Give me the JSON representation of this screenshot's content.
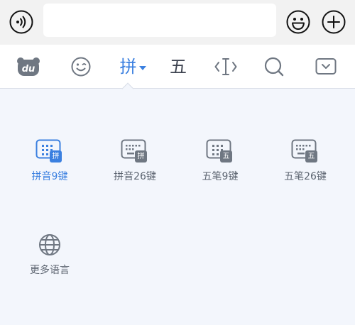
{
  "input": {
    "value": "",
    "placeholder": ""
  },
  "toolbar": {
    "items": [
      {
        "icon": "baidu-du-logo-icon",
        "text": "du"
      },
      {
        "icon": "emoji-face-icon"
      },
      {
        "icon": "pinyin-mode-icon",
        "text": "拼",
        "selected": true
      },
      {
        "icon": "wubi-mode-icon",
        "text": "五"
      },
      {
        "icon": "cursor-edit-icon"
      },
      {
        "icon": "search-icon"
      },
      {
        "icon": "hide-keyboard-icon"
      }
    ]
  },
  "layouts": {
    "items": [
      {
        "label": "拼音9键",
        "badge": "拼",
        "active": true
      },
      {
        "label": "拼音26键",
        "badge": "拼",
        "active": false
      },
      {
        "label": "五笔9键",
        "badge": "五",
        "active": false
      },
      {
        "label": "五笔26键",
        "badge": "五",
        "active": false
      },
      {
        "label": "更多语言",
        "icon": "globe-icon"
      }
    ]
  },
  "colors": {
    "accent": "#3b80e0",
    "icon_gray": "#6f7782",
    "badge_gray": "#6f7782",
    "panel_bg": "#f3f6fc",
    "topbar_bg": "#f2f2f2"
  }
}
